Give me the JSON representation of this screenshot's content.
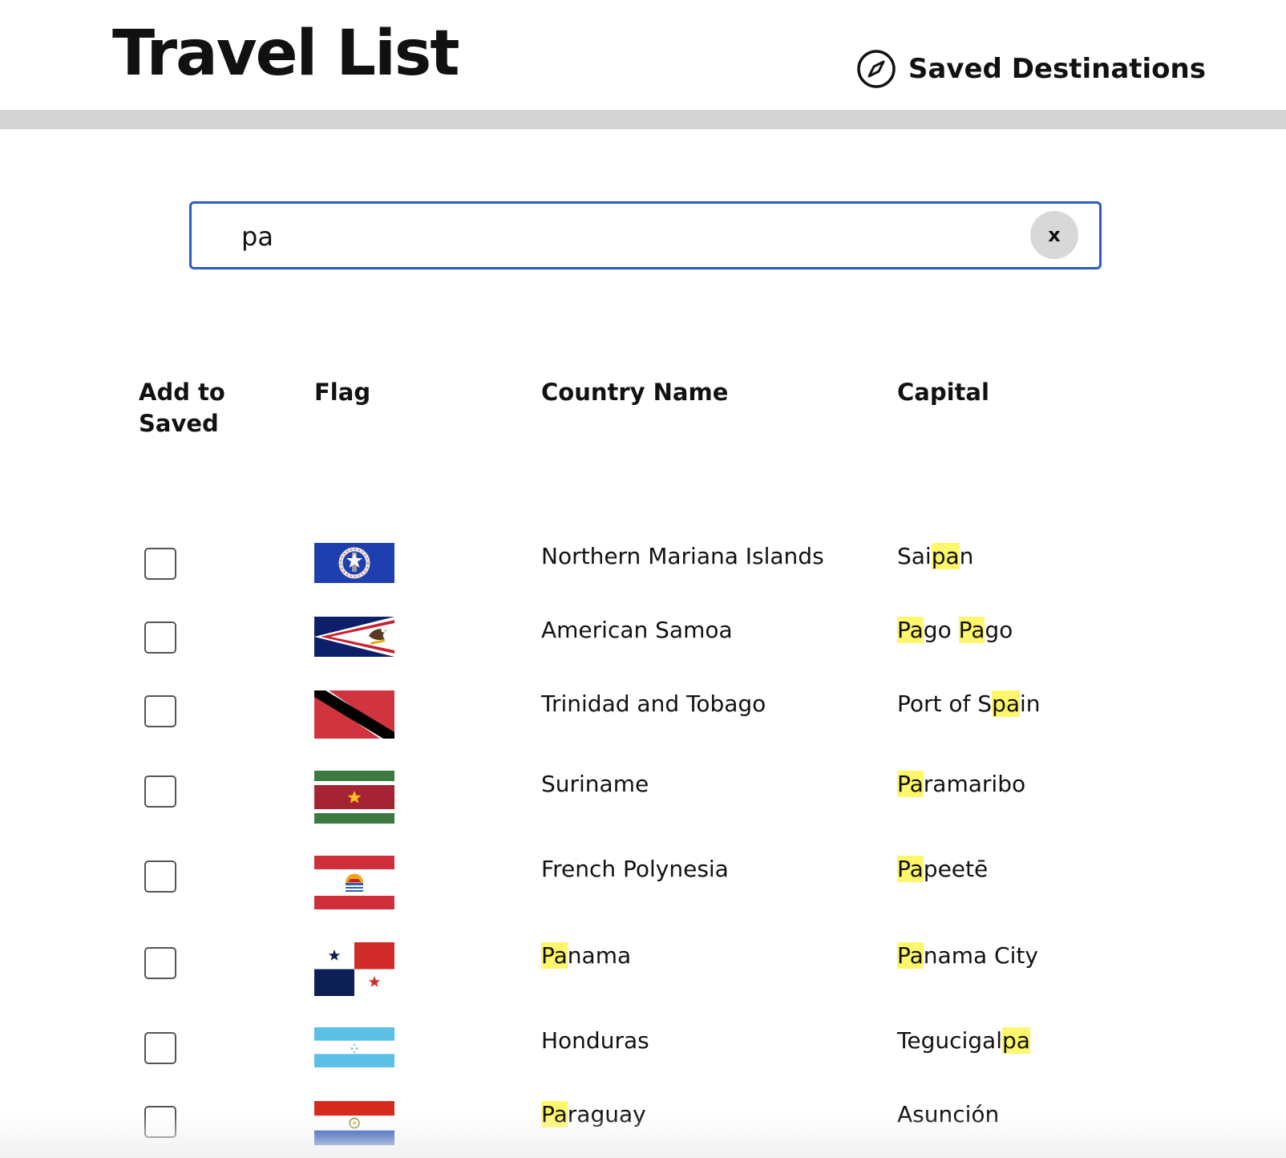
{
  "header": {
    "title": "Travel List",
    "saved_link_label": "Saved Destinations",
    "saved_link_icon": "compass-icon"
  },
  "search": {
    "value": "pa",
    "clear_label": "x"
  },
  "table": {
    "columns": [
      "Add to Saved",
      "Flag",
      "Country Name",
      "Capital"
    ],
    "rows": [
      {
        "country": "Northern Mariana Islands",
        "capital": "Saipan",
        "flag": "northern-mariana-islands-flag",
        "checked": false
      },
      {
        "country": "American Samoa",
        "capital": "Pago Pago",
        "flag": "american-samoa-flag",
        "checked": false
      },
      {
        "country": "Trinidad and Tobago",
        "capital": "Port of Spain",
        "flag": "trinidad-and-tobago-flag",
        "checked": false
      },
      {
        "country": "Suriname",
        "capital": "Paramaribo",
        "flag": "suriname-flag",
        "checked": false
      },
      {
        "country": "French Polynesia",
        "capital": "Papeetē",
        "flag": "french-polynesia-flag",
        "checked": false
      },
      {
        "country": "Panama",
        "capital": "Panama City",
        "flag": "panama-flag",
        "checked": false
      },
      {
        "country": "Honduras",
        "capital": "Tegucigalpa",
        "flag": "honduras-flag",
        "checked": false
      },
      {
        "country": "Paraguay",
        "capital": "Asunción",
        "flag": "paraguay-flag",
        "checked": false
      }
    ]
  },
  "colors": {
    "search_border": "#2b5cc6",
    "highlight": "#fff76b",
    "header_bar": "#d4d4d4"
  }
}
